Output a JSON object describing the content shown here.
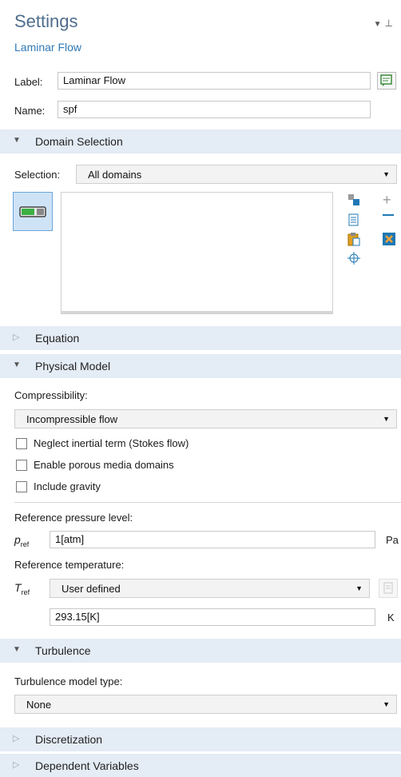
{
  "header": {
    "title": "Settings",
    "subtitle": "Laminar Flow"
  },
  "label_row": {
    "label": "Label:",
    "value": "Laminar Flow"
  },
  "name_row": {
    "label": "Name:",
    "value": "spf"
  },
  "sections": {
    "domain_selection": "Domain Selection",
    "equation": "Equation",
    "physical_model": "Physical Model",
    "turbulence": "Turbulence",
    "discretization": "Discretization",
    "dependent_variables": "Dependent Variables"
  },
  "selection": {
    "label": "Selection:",
    "value": "All domains"
  },
  "physical_model": {
    "compressibility_label": "Compressibility:",
    "compressibility_value": "Incompressible flow",
    "checkboxes": [
      {
        "label": "Neglect inertial term (Stokes flow)",
        "checked": false
      },
      {
        "label": "Enable porous media domains",
        "checked": false
      },
      {
        "label": "Include gravity",
        "checked": false
      }
    ],
    "ref_pressure_label": "Reference pressure level:",
    "p_symbol": "p",
    "p_sub": "ref",
    "p_value": "1[atm]",
    "p_unit": "Pa",
    "ref_temp_label": "Reference temperature:",
    "t_symbol": "T",
    "t_sub": "ref",
    "t_mode": "User defined",
    "t_value": "293.15[K]",
    "t_unit": "K"
  },
  "turbulence": {
    "type_label": "Turbulence model type:",
    "type_value": "None"
  },
  "colors": {
    "section_bg": "#e4ecf5",
    "title": "#4f6d8c",
    "subtitle": "#2f78b5"
  }
}
